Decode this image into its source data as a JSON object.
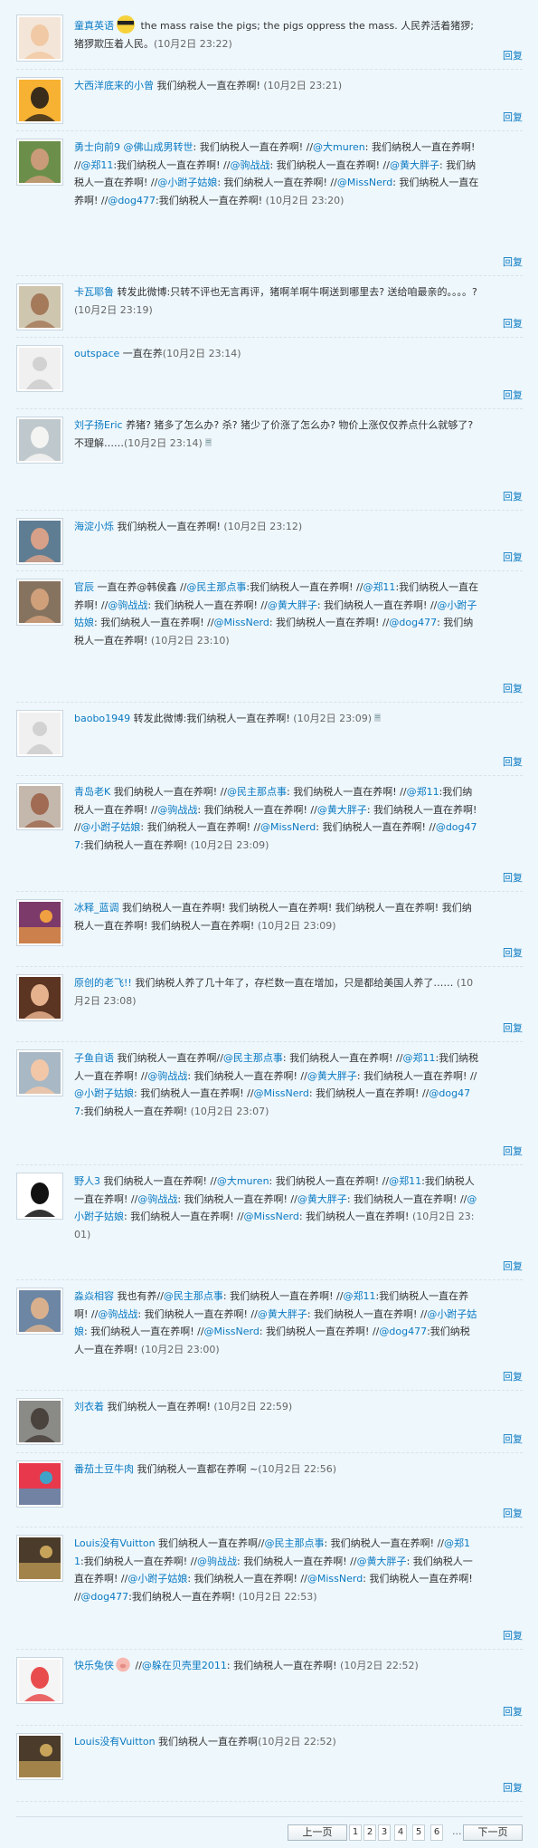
{
  "reply_label": "回复",
  "comments": [
    {
      "avatar": "baby",
      "segments": [
        [
          "n",
          "童真英语"
        ],
        [
          "e",
          "cool-face-emoticon"
        ],
        [
          "t",
          " the mass raise the pigs; the pigs oppress the mass. 人民养活着猪猡; 猪猡欺压着人民。"
        ],
        [
          "d",
          "(10月2日 23:22)"
        ]
      ]
    },
    {
      "avatar": "cartoon",
      "segments": [
        [
          "n",
          "大西洋底来的小曾"
        ],
        [
          "t",
          " 我们纳税人一直在养啊! "
        ],
        [
          "d",
          "(10月2日 23:21)"
        ]
      ]
    },
    {
      "avatar": "man-glasses",
      "segments": [
        [
          "n",
          "勇士向前9 @佛山成男转世"
        ],
        [
          "t",
          ": 我们纳税人一直在养啊! //"
        ],
        [
          "m",
          "@大muren"
        ],
        [
          "t",
          ": 我们纳税人一直在养啊! //"
        ],
        [
          "m",
          "@郑11"
        ],
        [
          "t",
          ":我们纳税人一直在养啊! //"
        ],
        [
          "m",
          "@驹战战"
        ],
        [
          "t",
          ": 我们纳税人一直在养啊! //"
        ],
        [
          "m",
          "@黄大胖子"
        ],
        [
          "t",
          ": 我们纳税人一直在养啊! //"
        ],
        [
          "m",
          "@小跗子姑娘"
        ],
        [
          "t",
          ": 我们纳税人一直在养啊! //"
        ],
        [
          "m",
          "@MissNerd"
        ],
        [
          "t",
          ": 我们纳税人一直在养啊! //"
        ],
        [
          "m",
          "@dog477"
        ],
        [
          "t",
          ":我们纳税人一直在养啊! "
        ],
        [
          "d",
          "(10月2日 23:20)"
        ]
      ]
    },
    {
      "avatar": "man-hat",
      "segments": [
        [
          "n",
          "卡瓦耶鲁"
        ],
        [
          "t",
          " 转发此微博:只转不评也无言再评，猪啊羊啊牛啊送到哪里去? 送给咱最亲的。。。。? "
        ],
        [
          "d",
          "(10月2日 23:19)"
        ]
      ]
    },
    {
      "avatar": "default",
      "segments": [
        [
          "n",
          "outspace"
        ],
        [
          "t",
          " 一直在养"
        ],
        [
          "d",
          "(10月2日 23:14)"
        ]
      ]
    },
    {
      "avatar": "dog",
      "segments": [
        [
          "n",
          "刘子扬Eric"
        ],
        [
          "t",
          " 养猪? 猪多了怎么办? 杀? 猪少了价涨了怎么办? 物价上涨仅仅养点什么就够了? 不理解……"
        ],
        [
          "d",
          "(10月2日 23:14)"
        ],
        [
          "e",
          "pencil-icon"
        ]
      ]
    },
    {
      "avatar": "woman",
      "segments": [
        [
          "n",
          "海淀小烁"
        ],
        [
          "t",
          " 我们纳税人一直在养啊! "
        ],
        [
          "d",
          "(10月2日 23:12)"
        ]
      ]
    },
    {
      "avatar": "man-wave",
      "segments": [
        [
          "n",
          "官辰"
        ],
        [
          "t",
          " 一直在养@韩侯鑫 //"
        ],
        [
          "m",
          "@民主那点事"
        ],
        [
          "t",
          ":我们纳税人一直在养啊! //"
        ],
        [
          "m",
          "@郑11"
        ],
        [
          "t",
          ":我们纳税人一直在养啊! //"
        ],
        [
          "m",
          "@驹战战"
        ],
        [
          "t",
          ": 我们纳税人一直在养啊! //"
        ],
        [
          "m",
          "@黄大胖子"
        ],
        [
          "t",
          ": 我们纳税人一直在养啊! //"
        ],
        [
          "m",
          "@小跗子姑娘"
        ],
        [
          "t",
          ": 我们纳税人一直在养啊! //"
        ],
        [
          "m",
          "@MissNerd"
        ],
        [
          "t",
          ": 我们纳税人一直在养啊! //"
        ],
        [
          "m",
          "@dog477"
        ],
        [
          "t",
          ": 我们纳税人一直在养啊! "
        ],
        [
          "d",
          "(10月2日 23:10)"
        ]
      ]
    },
    {
      "avatar": "default",
      "segments": [
        [
          "n",
          "baobo1949"
        ],
        [
          "t",
          " 转发此微博:我们纳税人一直在养啊! "
        ],
        [
          "d",
          "(10月2日 23:09)"
        ],
        [
          "e",
          "pencil-icon"
        ]
      ]
    },
    {
      "avatar": "man-bald",
      "segments": [
        [
          "n",
          "青岛老K"
        ],
        [
          "t",
          " 我们纳税人一直在养啊! //"
        ],
        [
          "m",
          "@民主那点事"
        ],
        [
          "t",
          ": 我们纳税人一直在养啊! //"
        ],
        [
          "m",
          "@郑11"
        ],
        [
          "t",
          ":我们纳税人一直在养啊! //"
        ],
        [
          "m",
          "@驹战战"
        ],
        [
          "t",
          ": 我们纳税人一直在养啊! //"
        ],
        [
          "m",
          "@黄大胖子"
        ],
        [
          "t",
          ": 我们纳税人一直在养啊! //"
        ],
        [
          "m",
          "@小跗子姑娘"
        ],
        [
          "t",
          ": 我们纳税人一直在养啊! //"
        ],
        [
          "m",
          "@MissNerd"
        ],
        [
          "t",
          ": 我们纳税人一直在养啊! //"
        ],
        [
          "m",
          "@dog477"
        ],
        [
          "t",
          ":我们纳税人一直在养啊! "
        ],
        [
          "d",
          "(10月2日 23:09)"
        ]
      ]
    },
    {
      "avatar": "sunset",
      "segments": [
        [
          "n",
          "冰释_蓝调"
        ],
        [
          "t",
          " 我们纳税人一直在养啊! 我们纳税人一直在养啊! 我们纳税人一直在养啊! 我们纳税人一直在养啊! 我们纳税人一直在养啊! "
        ],
        [
          "d",
          "(10月2日 23:09)"
        ]
      ]
    },
    {
      "avatar": "kiss",
      "segments": [
        [
          "n",
          "原创的老飞!!"
        ],
        [
          "t",
          " 我们纳税人养了几十年了，存栏数一直在增加，只是都给美国人养了…… "
        ],
        [
          "d",
          "(10月2日 23:08)"
        ]
      ]
    },
    {
      "avatar": "baby2",
      "segments": [
        [
          "n",
          "子鱼自语"
        ],
        [
          "t",
          " 我们纳税人一直在养啊//"
        ],
        [
          "m",
          "@民主那点事"
        ],
        [
          "t",
          ": 我们纳税人一直在养啊! //"
        ],
        [
          "m",
          "@郑11"
        ],
        [
          "t",
          ":我们纳税人一直在养啊! //"
        ],
        [
          "m",
          "@驹战战"
        ],
        [
          "t",
          ": 我们纳税人一直在养啊! //"
        ],
        [
          "m",
          "@黄大胖子"
        ],
        [
          "t",
          ": 我们纳税人一直在养啊! //"
        ],
        [
          "m",
          "@小跗子姑娘"
        ],
        [
          "t",
          ": 我们纳税人一直在养啊! //"
        ],
        [
          "m",
          "@MissNerd"
        ],
        [
          "t",
          ": 我们纳税人一直在养啊! //"
        ],
        [
          "m",
          "@dog477"
        ],
        [
          "t",
          ":我们纳税人一直在养啊! "
        ],
        [
          "d",
          "(10月2日 23:07)"
        ]
      ]
    },
    {
      "avatar": "silhouette",
      "segments": [
        [
          "n",
          "野人3"
        ],
        [
          "t",
          " 我们纳税人一直在养啊! //"
        ],
        [
          "m",
          "@大muren"
        ],
        [
          "t",
          ": 我们纳税人一直在养啊! //"
        ],
        [
          "m",
          "@郑11"
        ],
        [
          "t",
          ":我们纳税人一直在养啊! //"
        ],
        [
          "m",
          "@驹战战"
        ],
        [
          "t",
          ": 我们纳税人一直在养啊! //"
        ],
        [
          "m",
          "@黄大胖子"
        ],
        [
          "t",
          ": 我们纳税人一直在养啊! //"
        ],
        [
          "m",
          "@小跗子姑娘"
        ],
        [
          "t",
          ": 我们纳税人一直在养啊! //"
        ],
        [
          "m",
          "@MissNerd"
        ],
        [
          "t",
          ": 我们纳税人一直在养啊! "
        ],
        [
          "d",
          "(10月2日 23:01)"
        ]
      ]
    },
    {
      "avatar": "man-glasses2",
      "segments": [
        [
          "n",
          "淼焱相容"
        ],
        [
          "t",
          " 我也有养//"
        ],
        [
          "m",
          "@民主那点事"
        ],
        [
          "t",
          ": 我们纳税人一直在养啊! //"
        ],
        [
          "m",
          "@郑11"
        ],
        [
          "t",
          ":我们纳税人一直在养啊! //"
        ],
        [
          "m",
          "@驹战战"
        ],
        [
          "t",
          ": 我们纳税人一直在养啊! //"
        ],
        [
          "m",
          "@黄大胖子"
        ],
        [
          "t",
          ": 我们纳税人一直在养啊! //"
        ],
        [
          "m",
          "@小跗子姑娘"
        ],
        [
          "t",
          ": 我们纳税人一直在养啊! //"
        ],
        [
          "m",
          "@MissNerd"
        ],
        [
          "t",
          ": 我们纳税人一直在养啊! //"
        ],
        [
          "m",
          "@dog477"
        ],
        [
          "t",
          ":我们纳税人一直在养啊! "
        ],
        [
          "d",
          "(10月2日 23:00)"
        ]
      ]
    },
    {
      "avatar": "man-dark",
      "segments": [
        [
          "n",
          "刘衣着"
        ],
        [
          "t",
          " 我们纳税人一直在养啊! "
        ],
        [
          "d",
          "(10月2日 22:59)"
        ]
      ]
    },
    {
      "avatar": "album-red",
      "segments": [
        [
          "n",
          "番茄土豆牛肉"
        ],
        [
          "t",
          " 我们纳税人一直都在养啊 ~"
        ],
        [
          "d",
          "(10月2日 22:56)"
        ]
      ]
    },
    {
      "avatar": "album-dark",
      "segments": [
        [
          "n",
          "Louis没有Vuitton"
        ],
        [
          "t",
          " 我们纳税人一直在养啊//"
        ],
        [
          "m",
          "@民主那点事"
        ],
        [
          "t",
          ": 我们纳税人一直在养啊! //"
        ],
        [
          "m",
          "@郑11"
        ],
        [
          "t",
          ":我们纳税人一直在养啊! //"
        ],
        [
          "m",
          "@驹战战"
        ],
        [
          "t",
          ": 我们纳税人一直在养啊! //"
        ],
        [
          "m",
          "@黄大胖子"
        ],
        [
          "t",
          ": 我们纳税人一直在养啊! //"
        ],
        [
          "m",
          "@小跗子姑娘"
        ],
        [
          "t",
          ": 我们纳税人一直在养啊! //"
        ],
        [
          "m",
          "@MissNerd"
        ],
        [
          "t",
          ": 我们纳税人一直在养啊! //"
        ],
        [
          "m",
          "@dog477"
        ],
        [
          "t",
          ":我们纳税人一直在养啊! "
        ],
        [
          "d",
          "(10月2日 22:53)"
        ]
      ]
    },
    {
      "avatar": "rabbit",
      "segments": [
        [
          "n",
          "快乐兔侠"
        ],
        [
          "e",
          "pig-emoticon"
        ],
        [
          "t",
          " //"
        ],
        [
          "m",
          "@躲在贝壳里2011"
        ],
        [
          "t",
          ": 我们纳税人一直在养啊! "
        ],
        [
          "d",
          "(10月2日 22:52)"
        ]
      ]
    },
    {
      "avatar": "album-dark",
      "segments": [
        [
          "n",
          "Louis没有Vuitton"
        ],
        [
          "t",
          " 我们纳税人一直在养啊"
        ],
        [
          "d",
          "(10月2日 22:52)"
        ]
      ]
    }
  ],
  "pagination": {
    "prev_label": "上一页",
    "pages": [
      "1",
      "2",
      "3",
      "4",
      "5",
      "6"
    ],
    "ellipsis": "...",
    "next_label": "下一页"
  }
}
